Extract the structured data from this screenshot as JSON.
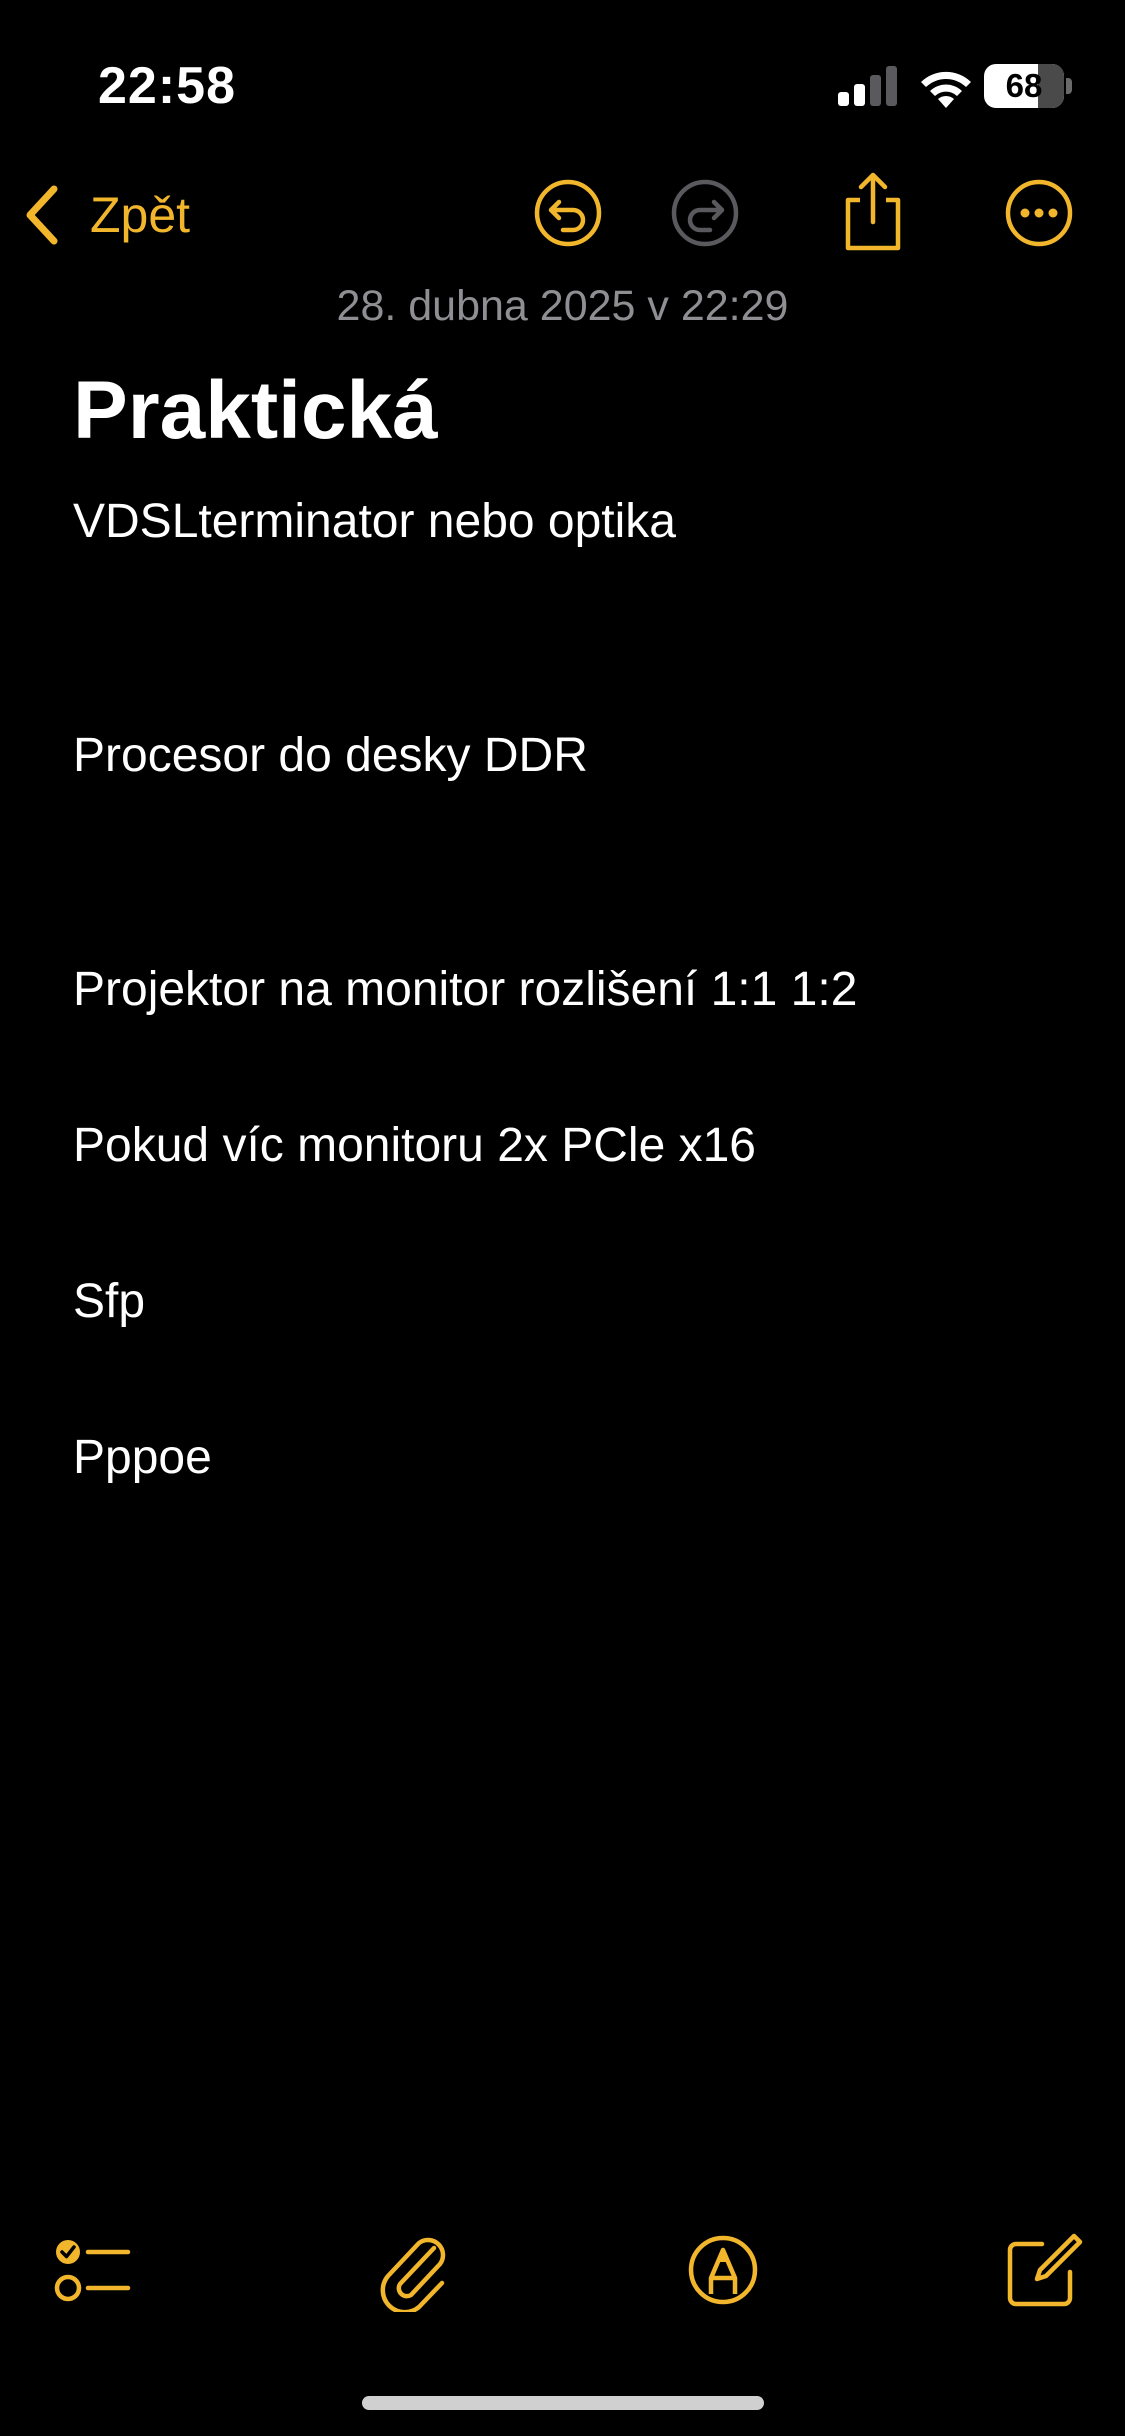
{
  "status_bar": {
    "time": "22:58",
    "battery_level": "68",
    "icons": [
      "signal-icon",
      "wifi-icon",
      "battery-icon"
    ]
  },
  "nav": {
    "back_label": "Zpět",
    "icons": [
      "chevron-left-icon",
      "undo-icon",
      "redo-icon",
      "share-icon",
      "more-icon"
    ]
  },
  "note": {
    "date": "28. dubna 2025 v 22:29",
    "title": "Praktická",
    "lines": [
      "VDSLterminator nebo optika",
      "Procesor do desky DDR",
      "Projektor na monitor rozlišení 1:1 1:2",
      "Pokud víc monitoru 2x PCle x16",
      "Sfp",
      "Pppoe"
    ]
  },
  "toolbar": {
    "icons": [
      "checklist-icon",
      "paperclip-icon",
      "markup-pen-icon",
      "compose-icon"
    ]
  },
  "colors": {
    "accent": "#f2b62c",
    "background": "#000000",
    "text": "#ffffff",
    "secondary_text": "#8e8e93",
    "disabled": "#5a5a5e"
  }
}
